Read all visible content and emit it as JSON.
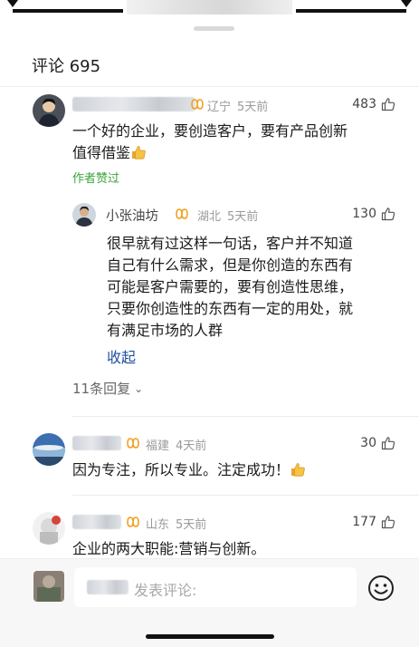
{
  "header": {
    "title": "评论 695"
  },
  "comments": [
    {
      "region": "辽宁",
      "time": "5天前",
      "likes": "483",
      "text_lines": [
        "一个好的企业，要创造客户，要有产品创新",
        "值得借鉴"
      ],
      "author_liked": "作者赞过",
      "reply": {
        "author": "小张油坊",
        "region": "湖北",
        "time": "5天前",
        "likes": "130",
        "text_lines": [
          "很早就有过这样一句话，客户并不知道",
          "自己有什么需求，但是你创造的东西有",
          "可能是客户需要的，要有创造性思维，",
          "只要你创造性的东西有一定的用处，就",
          "有满足市场的人群"
        ],
        "collapse": "收起"
      },
      "more_replies": "11条回复"
    },
    {
      "region": "福建",
      "time": "4天前",
      "likes": "30",
      "text_lines": [
        "因为专注，所以专业。注定成功！"
      ]
    },
    {
      "region": "山东",
      "time": "5天前",
      "likes": "177",
      "text_lines": [
        "企业的两大职能:营销与创新。"
      ]
    }
  ],
  "input": {
    "placeholder": "发表评论:"
  },
  "icons": {
    "like": "thumbs-up-icon",
    "vip": "vip-badge-icon",
    "emoji": "smiley-icon",
    "chevron": "chevron-down-icon"
  },
  "colors": {
    "accent_green": "#3aa43a",
    "link_blue": "#1f4fa0",
    "vip_orange": "#f0a020"
  }
}
